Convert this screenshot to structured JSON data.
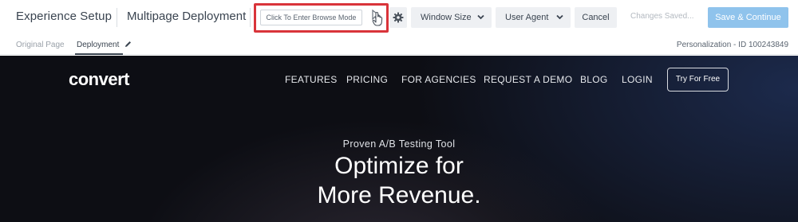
{
  "toolbar": {
    "app_title": "Experience Setup",
    "page_name": "Multipage Deployment",
    "browse_mode_label": "Click To Enter Browse Mode",
    "window_size_label": "Window Size",
    "user_agent_label": "User Agent",
    "cancel_label": "Cancel",
    "status_label": "Changes Saved...",
    "save_label": "Save & Continue"
  },
  "subbar": {
    "tabs": [
      "Original Page",
      "Deployment"
    ],
    "project_id": "Personalization - ID 100243849"
  },
  "site": {
    "logo": "convert",
    "nav": [
      "FEATURES",
      "PRICING",
      "FOR AGENCIES",
      "REQUEST A DEMO",
      "BLOG",
      "LOGIN"
    ],
    "cta": "Try For Free",
    "hero_sub": "Proven A/B Testing Tool",
    "hero_line1": "Optimize for",
    "hero_line2": "More Revenue."
  },
  "colors": {
    "highlight": "#d9343a",
    "save_button": "#8fc3ec",
    "site_background": "#0d0e14"
  },
  "icons": [
    "cursor-hand-icon",
    "gear-icon",
    "chevron-down-icon",
    "pencil-icon"
  ]
}
